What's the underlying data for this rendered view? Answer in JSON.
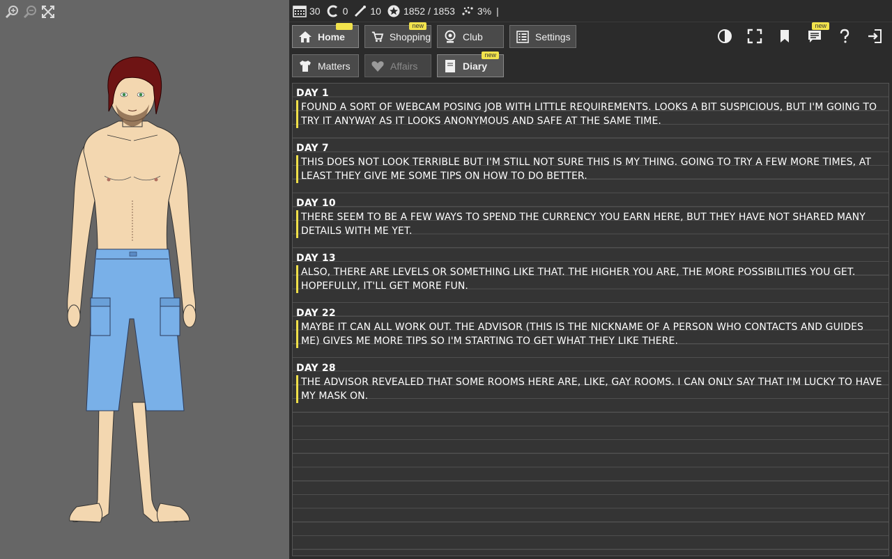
{
  "status": {
    "calendar": "30",
    "currency": "0",
    "energy": "10",
    "xp": "1852 / 1853",
    "progress": "3%",
    "separator": "|"
  },
  "nav": {
    "home": "Home",
    "shopping": "Shopping",
    "club": "Club",
    "settings": "Settings",
    "shopping_badge": "new",
    "notes_badge": "new"
  },
  "subnav": {
    "matters": "Matters",
    "affairs": "Affairs",
    "diary": "Diary",
    "diary_badge": "new"
  },
  "diary": [
    {
      "day": "DAY 1",
      "text": "Found a sort of webcam posing job with little requirements. Looks a bit suspicious, but I'm going to try it anyway as it looks anonymous and safe at the same time."
    },
    {
      "day": "DAY 7",
      "text": "This does not look terrible but I'm still not sure this is my thing. Going to try a few more times, at least they give me some tips on how to do better."
    },
    {
      "day": "DAY 10",
      "text": "There seem to be a few ways to spend the currency you earn here, but they have not shared many details with me yet."
    },
    {
      "day": "DAY 13",
      "text": "Also, there are levels or something like that. The higher you are, the more possibilities you get. Hopefully, it'll get more fun."
    },
    {
      "day": "DAY 22",
      "text": "Maybe it can all work out. The advisor (this is the nickname of a person who contacts and guides me) gives me more tips so I'm starting to get what they like there."
    },
    {
      "day": "DAY 28",
      "text": "The advisor revealed that some rooms here are, like, gay rooms. I can only say that I'm lucky to have my mask on."
    }
  ],
  "colors": {
    "accent": "#f0e04a",
    "panel_left": "#666666",
    "panel_right": "#2b2b2b"
  }
}
